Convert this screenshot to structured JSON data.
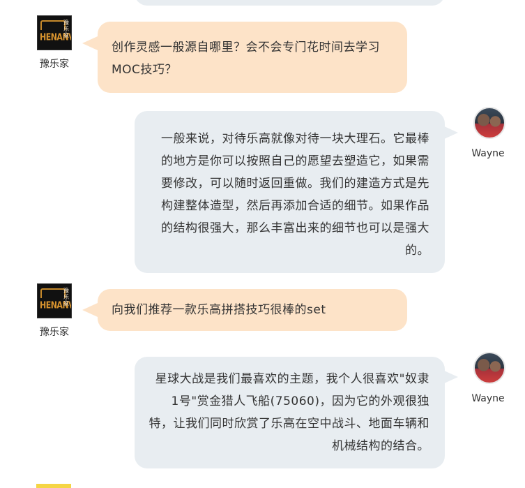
{
  "messages": [
    {
      "side": "left",
      "name": "豫乐家",
      "logo": {
        "cn": "豫乐家",
        "mark": "HENANVLUG"
      },
      "text": "创作灵感一般源自哪里？会不会专门花时间去学习MOC技巧？"
    },
    {
      "side": "right",
      "name": "Wayne",
      "text": "一般来说，对待乐高就像对待一块大理石。它最棒的地方是你可以按照自己的愿望去塑造它，如果需要修改，可以随时返回重做。我们的建造方式是先构建整体造型，然后再添加合适的细节。如果作品的结构很强大，那么丰富出来的细节也可以是强大的。"
    },
    {
      "side": "left",
      "name": "豫乐家",
      "logo": {
        "cn": "豫乐家",
        "mark": "HENANVLUG"
      },
      "text": "向我们推荐一款乐高拼搭技巧很棒的set"
    },
    {
      "side": "right",
      "name": "Wayne",
      "text": "星球大战是我们最喜欢的主题，我个人很喜欢\"奴隶1号\"赏金猎人飞船(75060)，因为它的外观很独特，让我们同时欣赏了乐高在空中战斗、地面车辆和机械结构的结合。"
    }
  ],
  "colors": {
    "left_bubble": "#fde3c8",
    "right_bubble": "#e8edf1",
    "logo_accent": "#d9942e"
  }
}
